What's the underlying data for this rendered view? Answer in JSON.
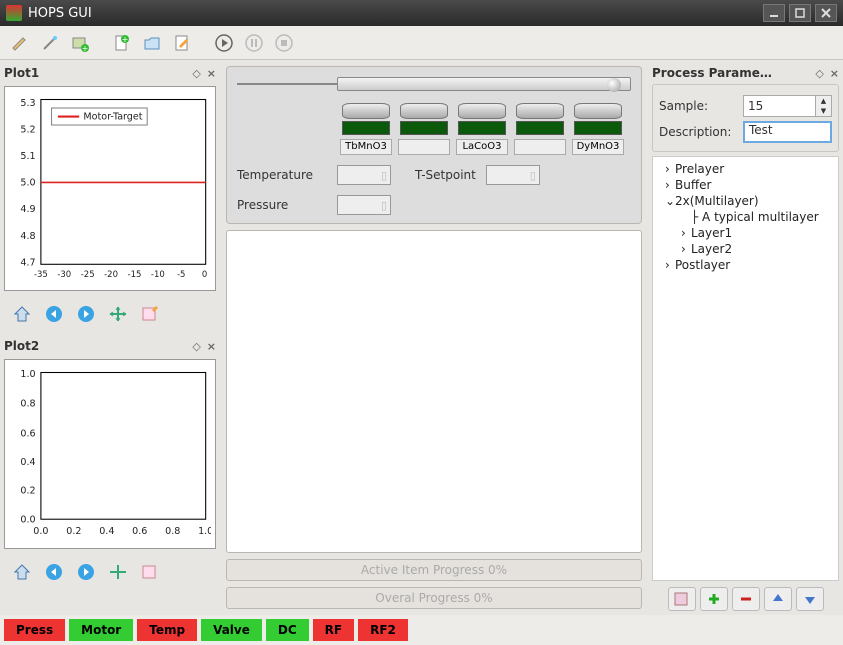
{
  "window": {
    "title": "HOPS GUI"
  },
  "plots": {
    "plot1": {
      "title": "Plot1",
      "legend": "Motor-Target",
      "y_ticks": [
        "5.3",
        "5.2",
        "5.1",
        "5.0",
        "4.9",
        "4.8",
        "4.7"
      ],
      "x_ticks": [
        "-35",
        "-30",
        "-25",
        "-20",
        "-15",
        "-10",
        "-5",
        "0"
      ],
      "hline_y": 5.0
    },
    "plot2": {
      "title": "Plot2",
      "y_ticks": [
        "1.0",
        "0.8",
        "0.6",
        "0.4",
        "0.2",
        "0.0"
      ],
      "x_ticks": [
        "0.0",
        "0.2",
        "0.4",
        "0.6",
        "0.8",
        "1.0"
      ]
    }
  },
  "device": {
    "slots": [
      {
        "label": "TbMnO3"
      },
      {
        "label": ""
      },
      {
        "label": "LaCoO3"
      },
      {
        "label": ""
      },
      {
        "label": "DyMnO3"
      }
    ],
    "params": {
      "temperature_label": "Temperature",
      "pressure_label": "Pressure",
      "tsetpoint_label": "T-Setpoint",
      "temperature": "",
      "pressure": "",
      "tsetpoint": ""
    }
  },
  "progress": {
    "active": "Active Item Progress 0%",
    "overall": "Overal Progress 0%"
  },
  "process": {
    "title": "Process Parame…",
    "sample_label": "Sample:",
    "sample_value": "15",
    "description_label": "Description:",
    "description_value": "Test",
    "tree": [
      {
        "label": "Prelayer",
        "expanded": false,
        "level": 0
      },
      {
        "label": "Buffer",
        "expanded": false,
        "level": 0
      },
      {
        "label": "2x(Multilayer)",
        "expanded": true,
        "level": 0
      },
      {
        "label": "A typical multilayer",
        "expanded": null,
        "level": 1
      },
      {
        "label": "Layer1",
        "expanded": false,
        "level": 1
      },
      {
        "label": "Layer2",
        "expanded": false,
        "level": 1
      },
      {
        "label": "Postlayer",
        "expanded": false,
        "level": 0
      }
    ]
  },
  "status_buttons": [
    {
      "label": "Press",
      "color": "#e33"
    },
    {
      "label": "Motor",
      "color": "#3c3"
    },
    {
      "label": "Temp",
      "color": "#e33"
    },
    {
      "label": "Valve",
      "color": "#3c3"
    },
    {
      "label": "DC",
      "color": "#3c3"
    },
    {
      "label": "RF",
      "color": "#e33"
    },
    {
      "label": "RF2",
      "color": "#e33"
    }
  ],
  "chart_data": [
    {
      "type": "line",
      "title": "Plot1",
      "series": [
        {
          "name": "Motor-Target",
          "y": 5.0,
          "x_range": [
            -35,
            0
          ]
        }
      ],
      "ylim": [
        4.7,
        5.3
      ],
      "xlim": [
        -35,
        0
      ]
    },
    {
      "type": "line",
      "title": "Plot2",
      "series": [],
      "ylim": [
        0.0,
        1.0
      ],
      "xlim": [
        0.0,
        1.0
      ]
    }
  ]
}
